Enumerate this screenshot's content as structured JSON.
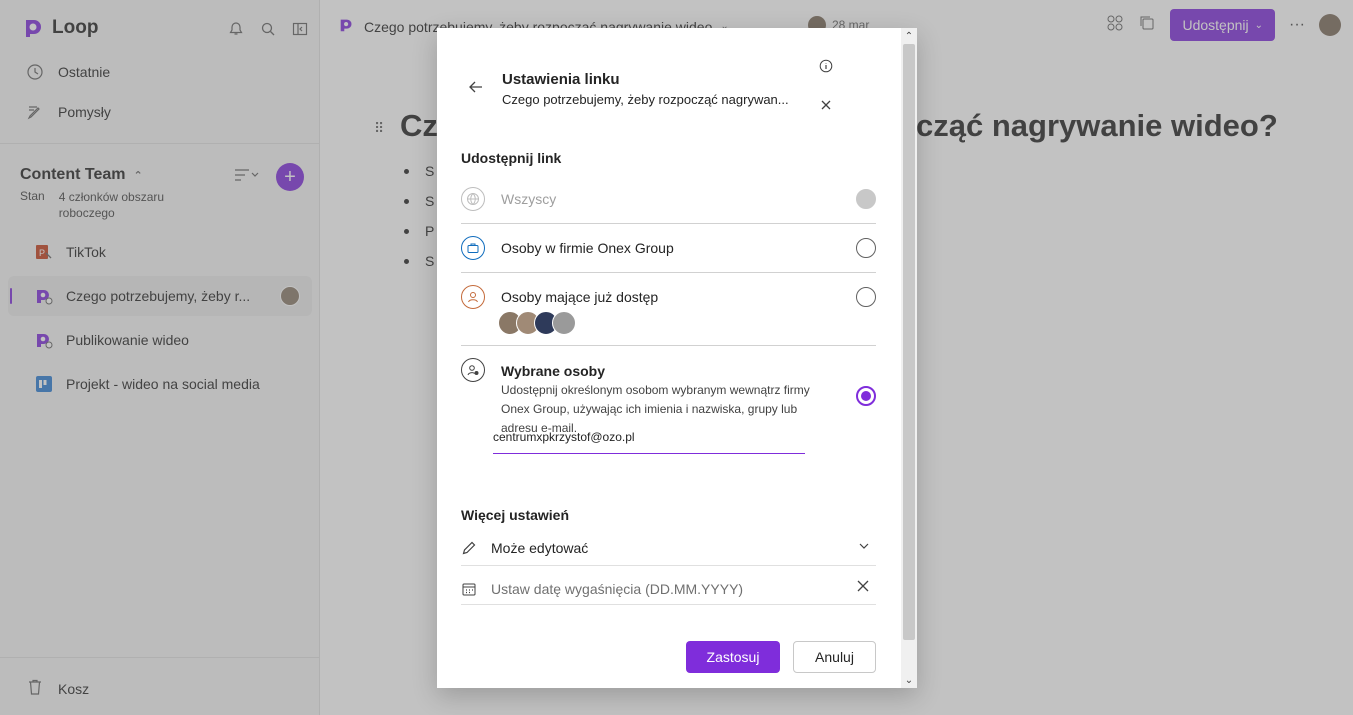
{
  "app": {
    "name": "Loop"
  },
  "sidebar": {
    "nav": [
      {
        "label": "Ostatnie",
        "icon": "clock-icon"
      },
      {
        "label": "Pomysły",
        "icon": "ideas-icon"
      }
    ],
    "workspace": {
      "title": "Content Team",
      "status": "Stan",
      "members": "4 członków obszaru roboczego"
    },
    "pages": [
      {
        "label": "TikTok",
        "icon": "powerpoint-icon"
      },
      {
        "label": "Czego potrzebujemy, żeby r...",
        "icon": "loop-page-icon",
        "active": true
      },
      {
        "label": "Publikowanie wideo",
        "icon": "loop-page-icon"
      },
      {
        "label": "Projekt - wideo na social media",
        "icon": "planner-icon"
      }
    ],
    "trash": "Kosz"
  },
  "topbar": {
    "doc_title": "Czego potrzebujemy, żeby rozpocząć nagrywanie wideo",
    "date": "28 mar",
    "share_label": "Udostępnij"
  },
  "document": {
    "heading_left": "Cz",
    "heading_right": "cząć nagrywanie wideo?",
    "bullets": [
      "S",
      "S",
      "P",
      "S"
    ]
  },
  "dialog": {
    "title": "Ustawienia linku",
    "subtitle": "Czego potrzebujemy, żeby rozpocząć nagrywan...",
    "share_section": "Udostępnij link",
    "options": {
      "everyone": "Wszyscy",
      "org": "Osoby w firmie Onex Group",
      "existing": "Osoby mające już dostęp",
      "specific": "Wybrane osoby",
      "specific_desc": "Udostępnij określonym osobom wybranym wewnątrz firmy Onex Group, używając ich imienia i nazwiska, grupy lub adresu e-mail."
    },
    "email_value": "centrumxpkrzystof@ozo.pl",
    "more_section": "Więcej ustawień",
    "permission": "Może edytować",
    "expiry_placeholder": "Ustaw datę wygaśnięcia (DD.MM.YYYY)",
    "apply_label": "Zastosuj",
    "cancel_label": "Anuluj"
  },
  "colors": {
    "accent": "#7f2ddb"
  }
}
